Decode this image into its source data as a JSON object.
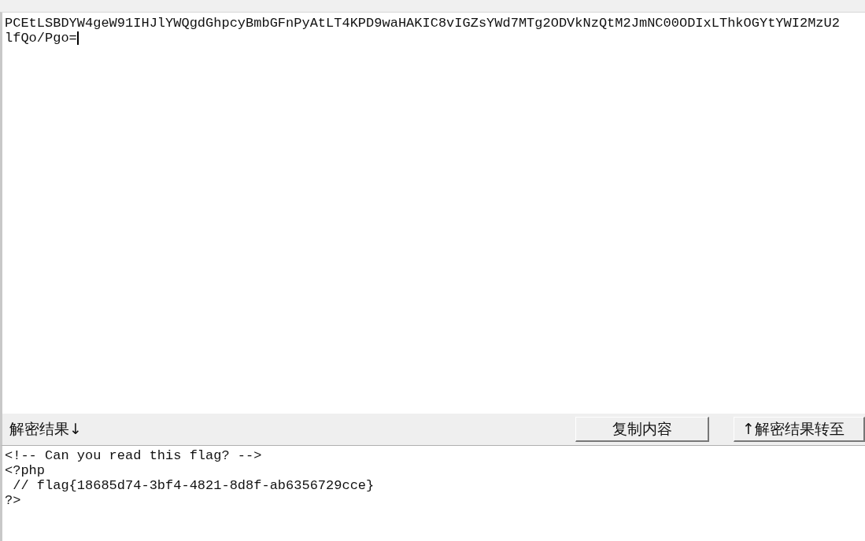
{
  "input": {
    "lines": [
      "PCEtLSBDYW4geW91IHJlYWQgdGhpcyBmbGFnPyAtLT4KPD9waHAKIC8vIGZsYWd7MTg2ODVkNzQtM2JmNC00ODIxLThkOGYtYWI2MzU2",
      "lfQo/Pgo="
    ]
  },
  "result_bar": {
    "label": "解密结果↓",
    "buttons": [
      {
        "kind": "copy",
        "label": "复制内容"
      },
      {
        "kind": "transfer",
        "label": "↑解密结果转至"
      }
    ]
  },
  "output": {
    "lines": [
      "<!-- Can you read this flag? -->",
      "<?php",
      " // flag{18685d74-3bf4-4821-8d8f-ab6356729cce}",
      "?>"
    ]
  }
}
